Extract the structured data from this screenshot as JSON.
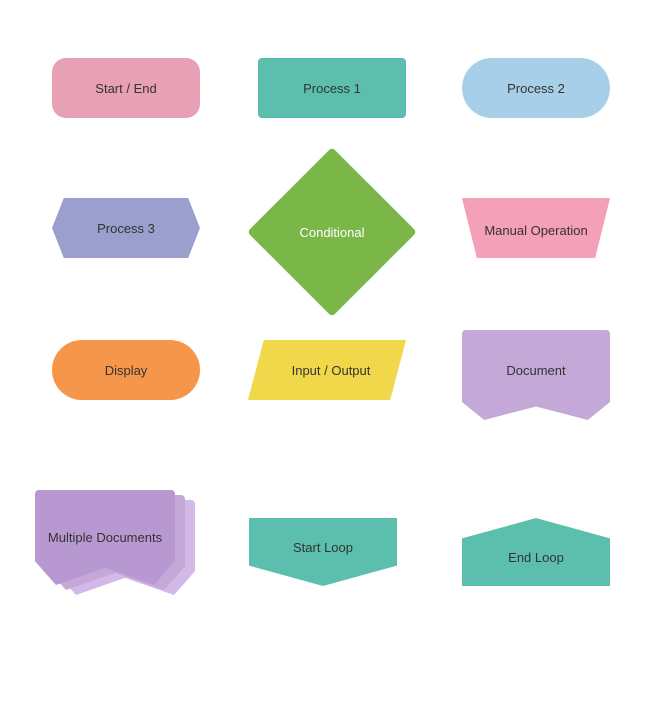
{
  "shapes": {
    "start_end": {
      "label": "Start / End"
    },
    "process1": {
      "label": "Process 1"
    },
    "process2": {
      "label": "Process 2"
    },
    "process3": {
      "label": "Process 3"
    },
    "conditional": {
      "label": "Conditional"
    },
    "manual_operation": {
      "label": "Manual Operation"
    },
    "display": {
      "label": "Display"
    },
    "input_output": {
      "label": "Input / Output"
    },
    "document": {
      "label": "Document"
    },
    "multiple_documents": {
      "label": "Multiple Documents"
    },
    "start_loop": {
      "label": "Start Loop"
    },
    "end_loop": {
      "label": "End Loop"
    }
  }
}
